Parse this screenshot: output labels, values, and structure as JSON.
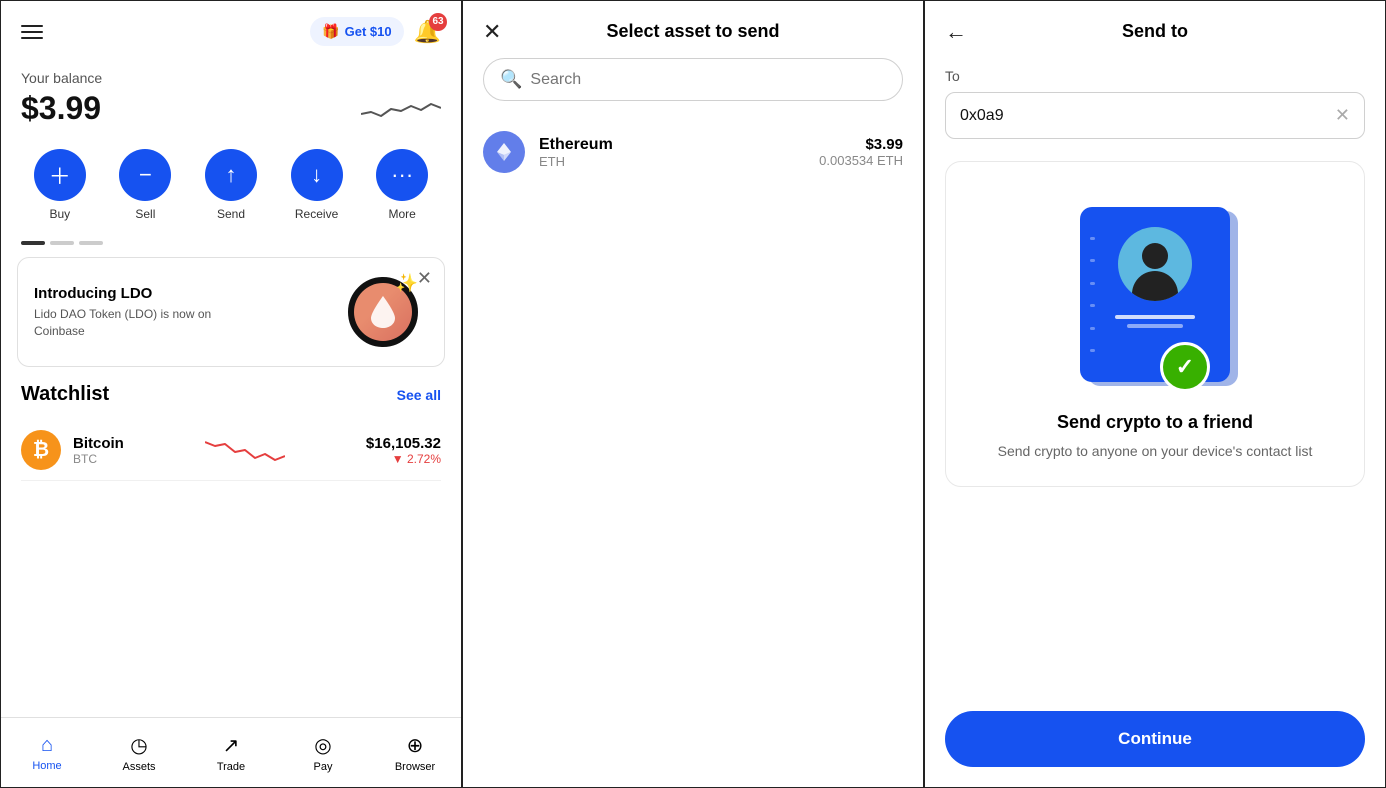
{
  "home": {
    "header": {
      "get_money_label": "Get $10",
      "notification_count": "63"
    },
    "balance": {
      "label": "Your balance",
      "amount": "$3.99"
    },
    "actions": [
      {
        "label": "Buy",
        "icon": "+"
      },
      {
        "label": "Sell",
        "icon": "−"
      },
      {
        "label": "Send",
        "icon": "↑"
      },
      {
        "label": "Receive",
        "icon": "↓"
      },
      {
        "label": "More",
        "icon": "•••"
      }
    ],
    "promo": {
      "title": "Introducing LDO",
      "description": "Lido DAO Token (LDO) is now on Coinbase"
    },
    "watchlist": {
      "title": "Watchlist",
      "see_all": "See all",
      "items": [
        {
          "name": "Bitcoin",
          "ticker": "BTC",
          "price": "$16,105.32",
          "change": "▼ 2.72%"
        }
      ]
    },
    "nav": [
      {
        "label": "Home",
        "icon": "⌂",
        "active": true
      },
      {
        "label": "Assets",
        "icon": "◷"
      },
      {
        "label": "Trade",
        "icon": "↗"
      },
      {
        "label": "Pay",
        "icon": "◎"
      },
      {
        "label": "Browser",
        "icon": "⊕"
      }
    ]
  },
  "select_asset": {
    "title": "Select asset to send",
    "search_placeholder": "Search",
    "assets": [
      {
        "name": "Ethereum",
        "ticker": "ETH",
        "usd_value": "$3.99",
        "crypto_value": "0.003534 ETH"
      }
    ]
  },
  "send_to": {
    "title": "Send to",
    "to_label": "To",
    "address": "0x0a9",
    "illustration": {
      "title": "Send crypto to a friend",
      "description": "Send crypto to anyone on your device's contact list"
    },
    "continue_label": "Continue"
  },
  "colors": {
    "blue": "#1652f0",
    "red": "#e53e3e",
    "green": "#38b000",
    "orange": "#f7931a"
  }
}
